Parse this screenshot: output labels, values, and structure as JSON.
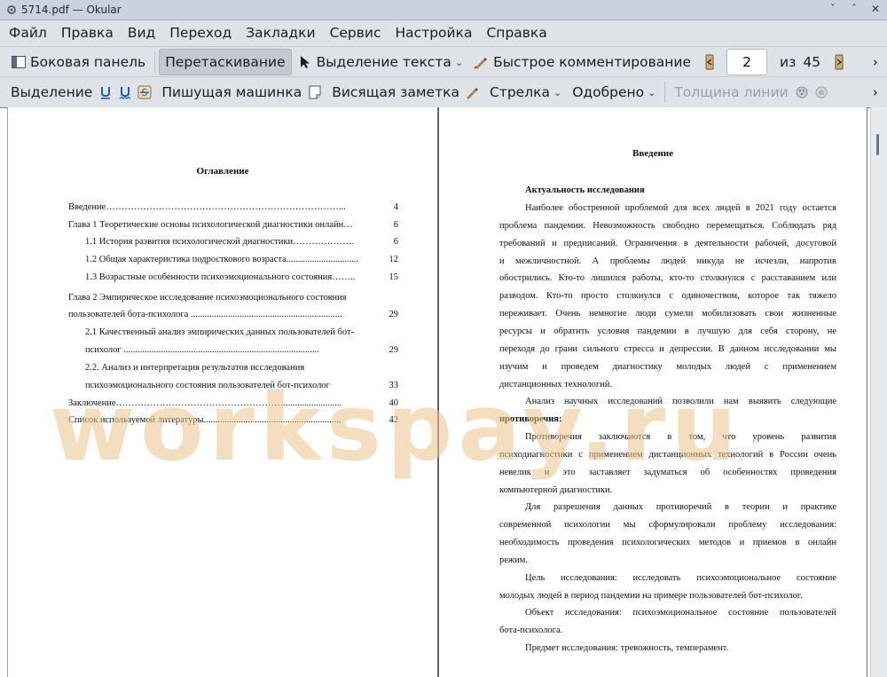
{
  "window": {
    "title": "5714.pdf  — Okular",
    "controls": [
      "ˇ",
      "ˆ",
      "✕"
    ]
  },
  "menu": [
    "Файл",
    "Правка",
    "Вид",
    "Переход",
    "Закладки",
    "Сервис",
    "Настройка",
    "Справка"
  ],
  "toolbar1": {
    "sidebar": "Боковая панель",
    "drag": "Перетаскивание",
    "text_select": "Выделение текста",
    "quick_comment": "Быстрое комментирование",
    "page_current": "2",
    "page_of": "из",
    "page_total": "45",
    "overflow": "›"
  },
  "toolbar2": {
    "selection": "Выделение",
    "typewriter": "Пишущая машинка",
    "sticky_note": "Висящая заметка",
    "arrow": "Стрелка",
    "approved": "Одобрено",
    "line_width": "Толщина линии",
    "overflow": "›"
  },
  "left_page": {
    "title": "Оглавление",
    "rows": [
      {
        "text": "Введение…………………………………………………………………...",
        "page": "4"
      },
      {
        "text": "Глава 1 Теоретические основы психологической диагностики онлайн…",
        "page": "6"
      },
      {
        "text": "1.1 История развития психологической диагностики………………..",
        "page": "6"
      },
      {
        "text": "1.2 Общая характеристика подросткового возраста...............................",
        "page": "12"
      },
      {
        "text": "1.3 Возрастные особенности психоэмоционального состояния……..",
        "page": "15"
      },
      {
        "text": "Глава 2 Эмпирическое исследование психоэмоционального состояния",
        "page": ""
      },
      {
        "text": "пользователей бота-психолога .................................................................",
        "page": "29"
      },
      {
        "text": "2.1 Качественный анализ эмпирических данных пользователей бот-",
        "page": ""
      },
      {
        "text": "психолог ....................................................................................",
        "page": "29"
      },
      {
        "text": "2.2. Анализ и интерпретация результатов исследования",
        "page": ""
      },
      {
        "text": "психоэмоционального состояния пользователей бот-психолог",
        "page": "33"
      },
      {
        "text": "Заключение……………………………………………….........................",
        "page": "40"
      },
      {
        "text": "Список используемой литературы...........................................................",
        "page": "42"
      }
    ]
  },
  "right_page": {
    "title": "Введение",
    "lines": [
      "Актуальность исследования",
      "Наиболее обостренной проблемой для всех людей в 2021 году остается",
      "проблема пандемии. Невозможность свободно перемещаться. Соблюдать ряд",
      "требований и предписаний. Ограничения в деятельности рабочей, досуговой",
      "и межличностной. А проблемы людей никуда не исчезли, напротив",
      "обострились. Кто-то лишился работы, кто-то столкнулся с расставанием или",
      "разводом. Кто-то просто столкнулся с одиночеством, которое так тяжело",
      "переживает. Очень немногие люди сумели мобилизовать свои жизненные",
      "ресурсы и обратить условия пандемии в лучшую для себя сторону, не",
      "переходя до грани сильного стресса и депрессии. В данном исследовании мы",
      "изучим и проведем диагностику молодых людей с применением",
      "дистанционных технологий.",
      "Анализ научных исследований позволили нам выявить следующие",
      "противоречия:",
      "Противоречия заключаются в том, что уровень развития",
      "психодиагностики с применением дистанционных технологий в России очень",
      "невелик и это заставляет задуматься об особенностях проведения",
      "компьютерной диагностики.",
      "Для разрешения данных противоречий в теории и практике",
      "современной психологии мы сформулировали проблему исследования:",
      "необходимость проведения психологических методов и приемов в онлайн",
      "режим.",
      "Цель исследования: исследовать психоэмоциональное состояние",
      "молодых людей в период пандемии на примере пользователей бот-психолог.",
      "Объект исследования: психоэмоциональное состояние пользователей",
      "бота-психолога.",
      "Предмет исследования: тревожность, темперамент."
    ]
  },
  "watermark": "workspay.ru"
}
